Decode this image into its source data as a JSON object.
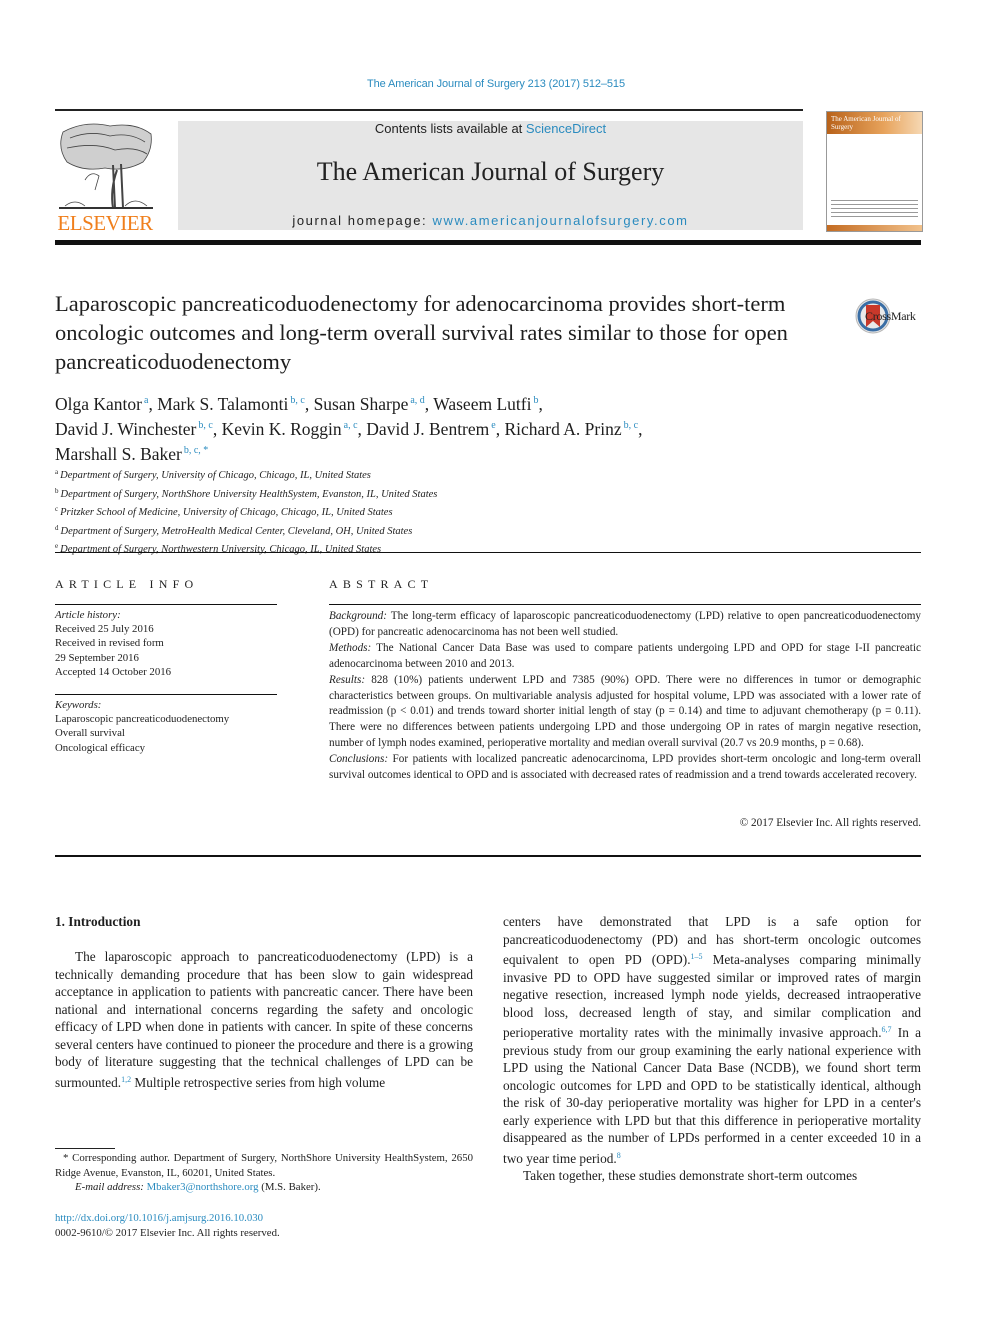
{
  "running_header": "The American Journal of Surgery 213 (2017) 512–515",
  "masthead": {
    "publisher_word": "ELSEVIER",
    "contents_prefix": "Contents lists available at ",
    "contents_link": "ScienceDirect",
    "journal_name": "The American Journal of Surgery",
    "homepage_prefix": "journal homepage: ",
    "homepage_link": "www.americanjournalofsurgery.com",
    "cover_title": "The American Journal of Surgery",
    "colors": {
      "link": "#2a8bbf",
      "elsevier_orange": "#f07f1c",
      "masthead_bg": "#e6e6e6"
    }
  },
  "article": {
    "title": "Laparoscopic pancreaticoduodenectomy for adenocarcinoma provides short-term oncologic outcomes and long-term overall survival rates similar to those for open pancreaticoduodenectomy",
    "crossmark_label": "CrossMark",
    "authors": [
      {
        "name": "Olga Kantor",
        "aff": "a",
        "sep": ", "
      },
      {
        "name": "Mark S. Talamonti",
        "aff": "b, c",
        "sep": ", "
      },
      {
        "name": "Susan Sharpe",
        "aff": "a, d",
        "sep": ", "
      },
      {
        "name": "Waseem Lutfi",
        "aff": "b",
        "sep": ","
      },
      {
        "name": "David J. Winchester",
        "aff": "b, c",
        "sep": ", "
      },
      {
        "name": "Kevin K. Roggin",
        "aff": "a, c",
        "sep": ", "
      },
      {
        "name": "David J. Bentrem",
        "aff": "e",
        "sep": ", "
      },
      {
        "name": "Richard A. Prinz",
        "aff": "b, c",
        "sep": ","
      },
      {
        "name": "Marshall S. Baker",
        "aff": "b, c, *",
        "sep": ""
      }
    ],
    "affiliations": [
      {
        "key": "a",
        "text": "Department of Surgery, University of Chicago, Chicago, IL, United States"
      },
      {
        "key": "b",
        "text": "Department of Surgery, NorthShore University HealthSystem, Evanston, IL, United States"
      },
      {
        "key": "c",
        "text": "Pritzker School of Medicine, University of Chicago, Chicago, IL, United States"
      },
      {
        "key": "d",
        "text": "Department of Surgery, MetroHealth Medical Center, Cleveland, OH, United States"
      },
      {
        "key": "e",
        "text": "Department of Surgery, Northwestern University, Chicago, IL, United States"
      }
    ]
  },
  "article_info": {
    "heading": "ARTICLE INFO",
    "history_label": "Article history:",
    "history": [
      "Received 25 July 2016",
      "Received in revised form",
      "29 September 2016",
      "Accepted 14 October 2016"
    ],
    "keywords_label": "Keywords:",
    "keywords": [
      "Laparoscopic pancreaticoduodenectomy",
      "Overall survival",
      "Oncological efficacy"
    ]
  },
  "abstract": {
    "heading": "ABSTRACT",
    "sections": [
      {
        "label": "Background:",
        "text": " The long-term efficacy of laparoscopic pancreaticoduodenectomy (LPD) relative to open pancreaticoduodenectomy (OPD) for pancreatic adenocarcinoma has not been well studied."
      },
      {
        "label": "Methods:",
        "text": " The National Cancer Data Base was used to compare patients undergoing LPD and OPD for stage I-II pancreatic adenocarcinoma between 2010 and 2013."
      },
      {
        "label": "Results:",
        "text": " 828 (10%) patients underwent LPD and 7385 (90%) OPD. There were no differences in tumor or demographic characteristics between groups. On multivariable analysis adjusted for hospital volume, LPD was associated with a lower rate of readmission (p < 0.01) and trends toward shorter initial length of stay (p = 0.14) and time to adjuvant chemotherapy (p = 0.11). There were no differences between patients undergoing LPD and those undergoing OP in rates of margin negative resection, number of lymph nodes examined, perioperative mortality and median overall survival (20.7 vs 20.9 months, p = 0.68)."
      },
      {
        "label": "Conclusions:",
        "text": " For patients with localized pancreatic adenocarcinoma, LPD provides short-term oncologic and long-term overall survival outcomes identical to OPD and is associated with decreased rates of readmission and a trend towards accelerated recovery."
      }
    ],
    "copyright": "© 2017 Elsevier Inc. All rights reserved."
  },
  "body": {
    "section_heading": "1.  Introduction",
    "left_p1_a": "The laparoscopic approach to pancreaticoduodenectomy (LPD) is a technically demanding procedure that has been slow to gain widespread acceptance in application to patients with pancreatic cancer. There have been national and international concerns regarding the safety and oncologic efficacy of LPD when done in patients with cancer. In spite of these concerns several centers have continued to pioneer the procedure and there is a growing body of literature suggesting that the technical challenges of LPD can be surmounted.",
    "left_p1_ref": "1,2",
    "left_p1_b": " Multiple retrospective series from high volume",
    "right_p1_a": "centers have demonstrated that LPD is a safe option for pancreaticoduodenectomy (PD) and has short-term oncologic outcomes equivalent to open PD (OPD).",
    "right_p1_ref1": "1–5",
    "right_p1_b": " Meta-analyses comparing minimally invasive PD to OPD have suggested similar or improved rates of margin negative resection, increased lymph node yields, decreased intraoperative blood loss, decreased length of stay, and similar complication and perioperative mortality rates with the minimally invasive approach.",
    "right_p1_ref2": "6,7",
    "right_p1_c": " In a previous study from our group examining the early national experience with LPD using the National Cancer Data Base (NCDB), we found short term oncologic outcomes for LPD and OPD to be statistically identical, although the risk of 30-day perioperative mortality was higher for LPD in a center's early experience with LPD but that this difference in perioperative mortality disappeared as the number of LPDs performed in a center exceeded 10 in a two year time period.",
    "right_p1_ref3": "8",
    "right_p2": "Taken together, these studies demonstrate short-term outcomes"
  },
  "footnote": {
    "corresponding": "* Corresponding author. Department of Surgery, NorthShore University HealthSystem, 2650 Ridge Avenue, Evanston, IL, 60201, United States.",
    "email_label": "E-mail address: ",
    "email": "Mbaker3@northshore.org",
    "email_suffix": " (M.S. Baker).",
    "doi": "http://dx.doi.org/10.1016/j.amjsurg.2016.10.030",
    "issn": "0002-9610/© 2017 Elsevier Inc. All rights reserved."
  }
}
